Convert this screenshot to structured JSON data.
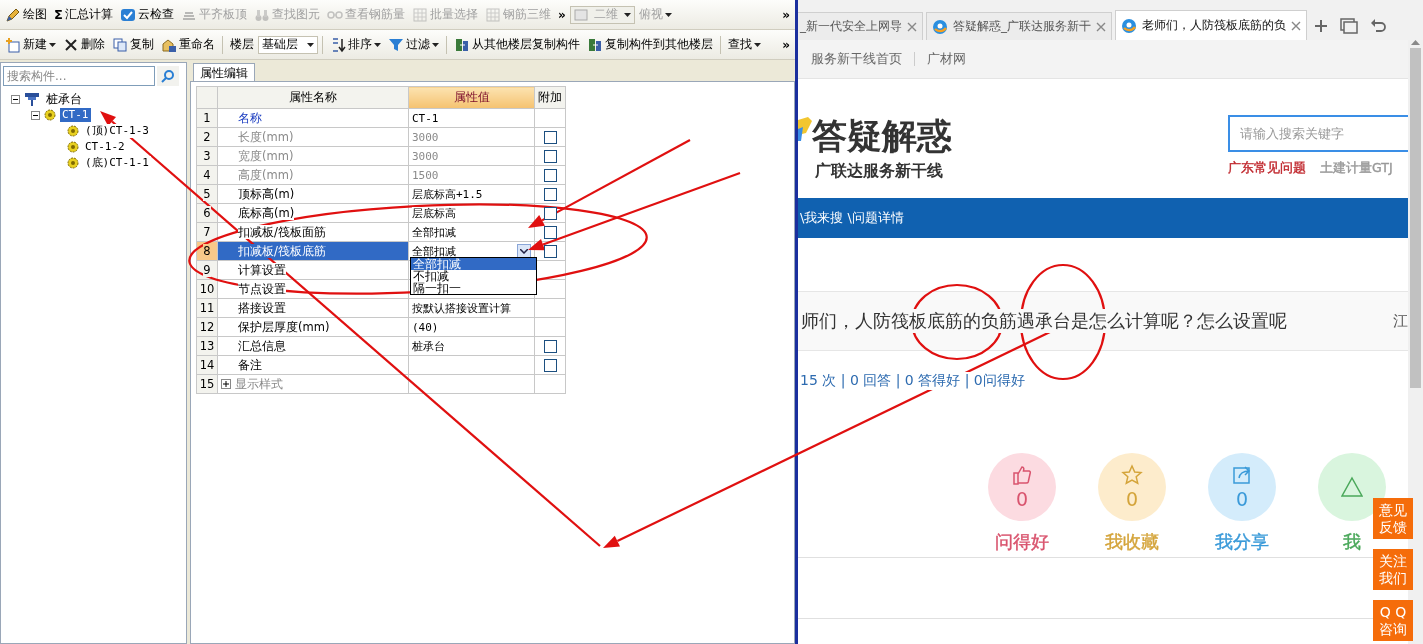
{
  "app": {
    "toolbar_1": [
      {
        "kind": "button",
        "label": "绘图",
        "disabled": false
      },
      {
        "kind": "button",
        "label": "汇总计算",
        "symbol": "Σ",
        "disabled": false
      },
      {
        "kind": "button",
        "label": "云检查",
        "disabled": false
      },
      {
        "kind": "button",
        "label": "平齐板顶",
        "disabled": true
      },
      {
        "kind": "button",
        "label": "查找图元",
        "disabled": true
      },
      {
        "kind": "button",
        "label": "查看钢筋量",
        "disabled": true
      },
      {
        "kind": "button",
        "label": "批量选择",
        "disabled": true
      },
      {
        "kind": "button",
        "label": "钢筋三维",
        "disabled": true
      },
      {
        "kind": "overflow",
        "label": "»"
      },
      {
        "kind": "combo",
        "label": "二维",
        "disabled": true
      },
      {
        "kind": "button",
        "label": "俯视",
        "disabled": true,
        "dropdown": true
      },
      {
        "kind": "overflow",
        "label": "»"
      }
    ],
    "toolbar_2": [
      {
        "kind": "button",
        "label": "新建",
        "disabled": false,
        "dropdown": true
      },
      {
        "kind": "button",
        "label": "删除",
        "disabled": false
      },
      {
        "kind": "button",
        "label": "复制",
        "disabled": false
      },
      {
        "kind": "button",
        "label": "重命名",
        "disabled": false
      },
      {
        "kind": "separator"
      },
      {
        "kind": "label",
        "label": "楼层"
      },
      {
        "kind": "combo",
        "label": "基础层",
        "disabled": false
      },
      {
        "kind": "separator"
      },
      {
        "kind": "button",
        "label": "排序",
        "disabled": false,
        "dropdown": true
      },
      {
        "kind": "button",
        "label": "过滤",
        "disabled": false,
        "dropdown": true
      },
      {
        "kind": "separator"
      },
      {
        "kind": "button",
        "label": "从其他楼层复制构件",
        "disabled": false
      },
      {
        "kind": "button",
        "label": "复制构件到其他楼层",
        "disabled": false
      },
      {
        "kind": "separator"
      },
      {
        "kind": "button",
        "label": "查找",
        "disabled": false,
        "dropdown": true
      },
      {
        "kind": "overflow",
        "label": "»"
      }
    ],
    "search": {
      "placeholder": "搜索构件..."
    },
    "tree": [
      {
        "label": "桩承台",
        "selected": false,
        "expanded": true,
        "children": [
          {
            "label": "CT-1",
            "selected": true,
            "expanded": true,
            "children": [
              {
                "label": "(顶)CT-1-3",
                "selected": false
              },
              {
                "label": "CT-1-2",
                "selected": false
              },
              {
                "label": "(底)CT-1-1",
                "selected": false
              }
            ]
          }
        ]
      }
    ],
    "tabs": [
      {
        "label": "属性编辑",
        "selected": true
      }
    ],
    "grid": {
      "columns": [
        "属性名称",
        "属性值",
        "附加"
      ],
      "rows": [
        {
          "num": "1",
          "kind": "primary",
          "name": "名称",
          "value": "CT-1",
          "selected": false
        },
        {
          "num": "2",
          "kind": "readonly",
          "name": "长度(mm)",
          "value": "3000",
          "selected": false,
          "checked": false
        },
        {
          "num": "3",
          "kind": "readonly",
          "name": "宽度(mm)",
          "value": "3000",
          "selected": false,
          "checked": false
        },
        {
          "num": "4",
          "kind": "readonly",
          "name": "高度(mm)",
          "value": "1500",
          "selected": false,
          "checked": false
        },
        {
          "num": "5",
          "kind": "plain",
          "name": "顶标高(m)",
          "value": "层底标高+1.5",
          "selected": false,
          "checked": false
        },
        {
          "num": "6",
          "kind": "plain",
          "name": "底标高(m)",
          "value": "层底标高",
          "selected": false,
          "checked": false
        },
        {
          "num": "7",
          "kind": "plain",
          "name": "扣减板/筏板面筋",
          "value": "全部扣减",
          "selected": false,
          "checked": false
        },
        {
          "num": "8",
          "kind": "plain",
          "name": "扣减板/筏板底筋",
          "value": "全部扣减",
          "selected": true,
          "checked": false,
          "options": [
            {
              "label": "全部扣减",
              "selected": true
            },
            {
              "label": "不扣减",
              "selected": false
            },
            {
              "label": "隔一扣一",
              "selected": false
            }
          ]
        },
        {
          "num": "9",
          "kind": "plain",
          "name": "计算设置",
          "selected": false
        },
        {
          "num": "10",
          "kind": "plain",
          "name": "节点设置",
          "selected": false
        },
        {
          "num": "11",
          "kind": "plain",
          "name": "搭接设置",
          "value": "按默认搭接设置计算",
          "selected": false
        },
        {
          "num": "12",
          "kind": "plain",
          "name": "保护层厚度(mm)",
          "value": "(40)",
          "selected": false
        },
        {
          "num": "13",
          "kind": "plain",
          "name": "汇总信息",
          "value": "桩承台",
          "selected": false,
          "checked": false
        },
        {
          "num": "14",
          "kind": "plain",
          "name": "备注",
          "selected": false,
          "checked": false
        },
        {
          "num": "15",
          "kind": "group",
          "name": "显示样式",
          "selected": false,
          "expanded": false
        }
      ]
    }
  },
  "browser": {
    "tabs": [
      {
        "title": "_新一代安全上网导",
        "selected": false
      },
      {
        "title": "答疑解惑_广联达服务新干",
        "selected": false
      },
      {
        "title": "老师们，人防筏板底筋的负",
        "selected": true
      }
    ],
    "bookmarks": [
      "服务新干线首页",
      "广材网"
    ],
    "logo": {
      "title": "答疑解惑",
      "subtitle": "广联达服务新干线"
    },
    "search": {
      "placeholder": "请输入搜索关键字"
    },
    "hot_links": [
      {
        "label": "广东常见问题",
        "color": "#c0272d"
      },
      {
        "label": "土建计量GTJ",
        "color": "#999999"
      }
    ],
    "breadcrumb": [
      "\\我来搜",
      "\\问题详情"
    ],
    "question": {
      "title": "师们，人防筏板底筋的负筋遇承台是怎么计算呢？怎么设置呢",
      "author": "江",
      "stats": "15 次 | 0 回答 | 0 答得好 | 0问得好"
    },
    "actions": [
      {
        "label": "问得好",
        "count": "0",
        "color": "#d9546e"
      },
      {
        "label": "我收藏",
        "count": "0",
        "color": "#d4a43a"
      },
      {
        "label": "我分享",
        "count": "0",
        "color": "#3a9ad9"
      },
      {
        "label": "我",
        "color": "#4aa85a"
      }
    ],
    "float_buttons": [
      {
        "lines": [
          "意见",
          "反馈"
        ]
      },
      {
        "lines": [
          "关注",
          "我们"
        ]
      },
      {
        "lines": [
          "Q Q",
          "咨询"
        ]
      }
    ]
  }
}
